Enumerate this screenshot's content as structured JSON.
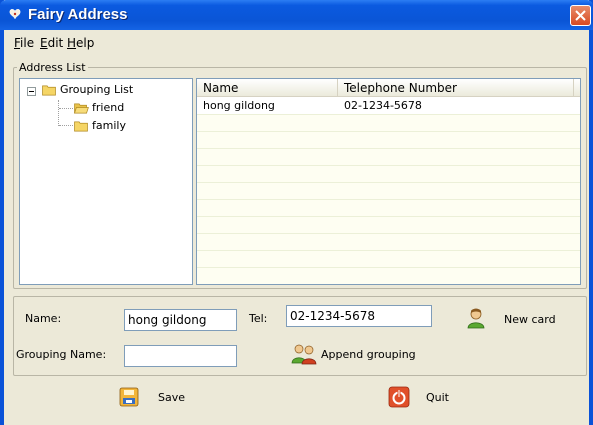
{
  "window": {
    "title": "Fairy Address"
  },
  "menu": [
    {
      "label": "File",
      "hotkey": "F",
      "rest": "ile"
    },
    {
      "label": "Edit",
      "hotkey": "E",
      "rest": "dit"
    },
    {
      "label": "Help",
      "hotkey": "H",
      "rest": "elp"
    }
  ],
  "address_list": {
    "group_title": "Address List",
    "tree": {
      "root": "Grouping List",
      "children": [
        "friend",
        "family"
      ]
    },
    "columns": [
      "Name",
      "Telephone Number"
    ],
    "rows": [
      {
        "name": "hong gildong",
        "tel": "02-1234-5678"
      }
    ]
  },
  "form": {
    "name_label": "Name:",
    "name_value": "hong gildong",
    "tel_label": "Tel:",
    "tel_value": "02-1234-5678",
    "grouping_label": "Grouping Name:",
    "grouping_value": ""
  },
  "actions": {
    "new_card": "New card",
    "append_grouping": "Append grouping",
    "save": "Save",
    "quit": "Quit"
  },
  "colors": {
    "titlebar": "#0a55d6",
    "close": "#d84a22",
    "window_bg": "#ece9d8",
    "folder": "#f5d565"
  }
}
